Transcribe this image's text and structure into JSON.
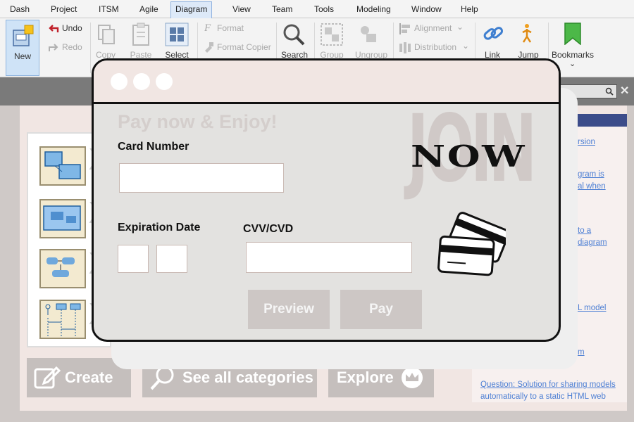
{
  "menubar": {
    "items": [
      "Dash",
      "Project",
      "ITSM",
      "Agile",
      "Diagram",
      "View",
      "Team",
      "Tools",
      "Modeling",
      "Window",
      "Help"
    ],
    "active": "Diagram"
  },
  "ribbon": {
    "new_label": "New",
    "undo_label": "Undo",
    "redo_label": "Redo",
    "copy_label": "Copy",
    "paste_label": "Paste",
    "select_label": "Select",
    "format_label": "Format",
    "format_copier_label": "Format Copier",
    "search_label": "Search",
    "group_label": "Group",
    "ungroup_label": "Ungroup",
    "alignment_label": "Alignment",
    "distribution_label": "Distribution",
    "link_label": "Link",
    "jump_label": "Jump",
    "bookmarks_label": "Bookmarks"
  },
  "right_panel": {
    "fragments": [
      "rsion",
      "gram is",
      "al when",
      "to a",
      "diagram",
      "L model",
      "m"
    ],
    "question_line1": "Question: Solution for sharing models",
    "question_line2": "automatically to a static HTML web"
  },
  "bottom_actions": {
    "create_label": "Create",
    "categories_label": "See all categories",
    "explore_label": "Explore"
  },
  "payment": {
    "heading": "Pay now & Enjoy!",
    "join_text": "JOIN",
    "now_text": "NOW",
    "card_number_label": "Card Number",
    "card_number_value": "",
    "expiration_label": "Expiration Date",
    "expiry_month_value": "",
    "expiry_year_value": "",
    "cvv_label": "CVV/CVD",
    "cvv_value": "",
    "preview_label": "Preview",
    "pay_label": "Pay"
  },
  "colors": {
    "window_bg": "#e3e2e0",
    "titlebar_bg": "#f1e6e3",
    "button_bg": "#cdc7c5",
    "link_blue": "#4d7fd4",
    "active_menu": "#dde9f8"
  }
}
